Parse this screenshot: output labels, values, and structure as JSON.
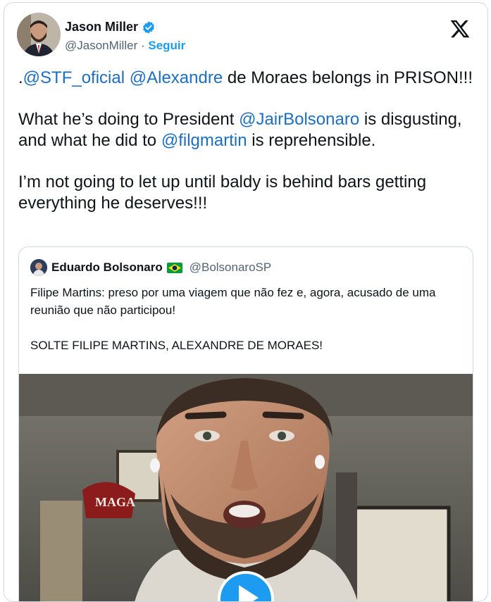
{
  "author": {
    "name": "Jason Miller",
    "handle": "@JasonMiller",
    "separator": "·",
    "follow_label": "Seguir"
  },
  "tweet": {
    "line1": {
      "prefix": ".",
      "mention1": "@STF_oficial",
      "mention2": "@Alexandre",
      "rest": " de Moraes belongs in PRISON!!!"
    },
    "line2": {
      "t1": "What he’s doing to President ",
      "mention1": "@JairBolsonaro",
      "t2": " is disgusting, and what he did to ",
      "mention2": "@filgmartin",
      "t3": " is reprehensible."
    },
    "line3": "I’m not going to let up until baldy is behind bars getting everything he deserves!!!"
  },
  "quoted": {
    "name": "Eduardo Bolsonaro",
    "flag": "brazil-flag-icon",
    "handle": "@BolsonaroSP",
    "para1": "Filipe Martins: preso por uma viagem que não fez e, agora, acusado de uma reunião que não participou!",
    "para2": "SOLTE FILIPE MARTINS, ALEXANDRE DE MORAES!",
    "media_hat_text": "MAGA"
  },
  "colors": {
    "mention": "#1d6ec2",
    "follow": "#1d9bf0",
    "verified": "#1d9bf0"
  }
}
